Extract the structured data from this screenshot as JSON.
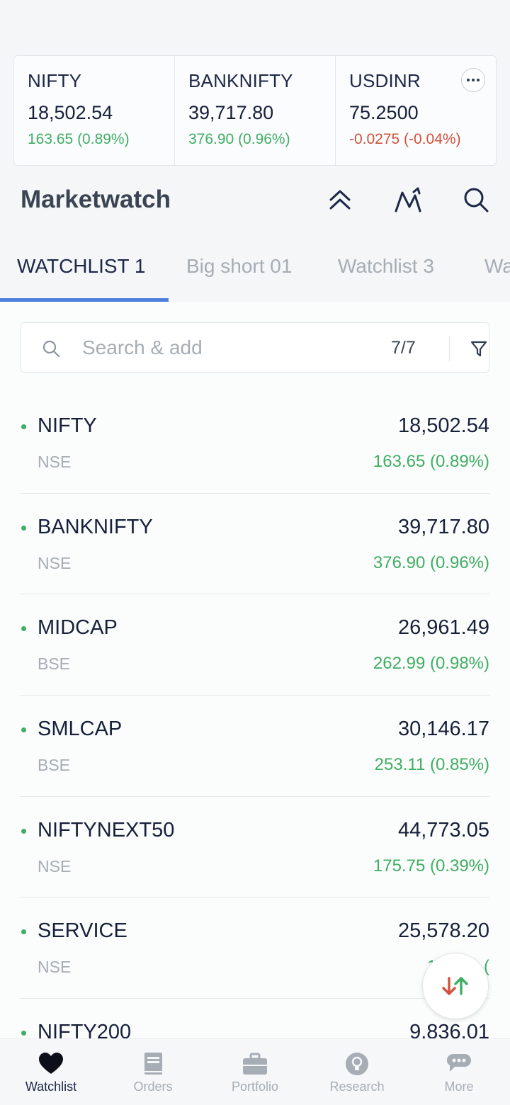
{
  "indices": [
    {
      "name": "NIFTY",
      "value": "18,502.54",
      "change": "163.65 (0.89%)",
      "direction": "up"
    },
    {
      "name": "BANKNIFTY",
      "value": "39,717.80",
      "change": "376.90 (0.96%)",
      "direction": "up"
    },
    {
      "name": "USDINR",
      "value": "75.2500",
      "change": "-0.0275 (-0.04%)",
      "direction": "down"
    }
  ],
  "header": {
    "title": "Marketwatch",
    "icons": [
      "collapse-up-icon",
      "chart-icon",
      "search-icon"
    ]
  },
  "tabs": [
    {
      "label": "WATCHLIST 1",
      "active": true
    },
    {
      "label": "Big short 01",
      "active": false
    },
    {
      "label": "Watchlist 3",
      "active": false
    },
    {
      "label": "Wa",
      "active": false
    }
  ],
  "search": {
    "placeholder": "Search & add",
    "value": "",
    "count": "7/7"
  },
  "watchlist": [
    {
      "symbol": "NIFTY",
      "exchange": "NSE",
      "price": "18,502.54",
      "change": "163.65 (0.89%)"
    },
    {
      "symbol": "BANKNIFTY",
      "exchange": "NSE",
      "price": "39,717.80",
      "change": "376.90 (0.96%)"
    },
    {
      "symbol": "MIDCAP",
      "exchange": "BSE",
      "price": "26,961.49",
      "change": "262.99 (0.98%)"
    },
    {
      "symbol": "SMLCAP",
      "exchange": "BSE",
      "price": "30,146.17",
      "change": "253.11 (0.85%)"
    },
    {
      "symbol": "NIFTYNEXT50",
      "exchange": "NSE",
      "price": "44,773.05",
      "change": "175.75 (0.39%)"
    },
    {
      "symbol": "SERVICE",
      "exchange": "NSE",
      "price": "25,578.20",
      "change": "190.90 ("
    },
    {
      "symbol": "NIFTY200",
      "exchange": "",
      "price": "9,836.01",
      "change": ""
    }
  ],
  "bottom_nav": [
    {
      "label": "Watchlist",
      "icon": "heart-icon",
      "active": true
    },
    {
      "label": "Orders",
      "icon": "book-icon",
      "active": false
    },
    {
      "label": "Portfolio",
      "icon": "briefcase-icon",
      "active": false
    },
    {
      "label": "Research",
      "icon": "lightbulb-icon",
      "active": false
    },
    {
      "label": "More",
      "icon": "chat-bubble-icon",
      "active": false
    }
  ],
  "colors": {
    "accent": "#4c7fdb",
    "positive": "#3fae62",
    "negative": "#d1523c",
    "text_primary": "#17203a",
    "text_muted": "#a6adb5"
  }
}
